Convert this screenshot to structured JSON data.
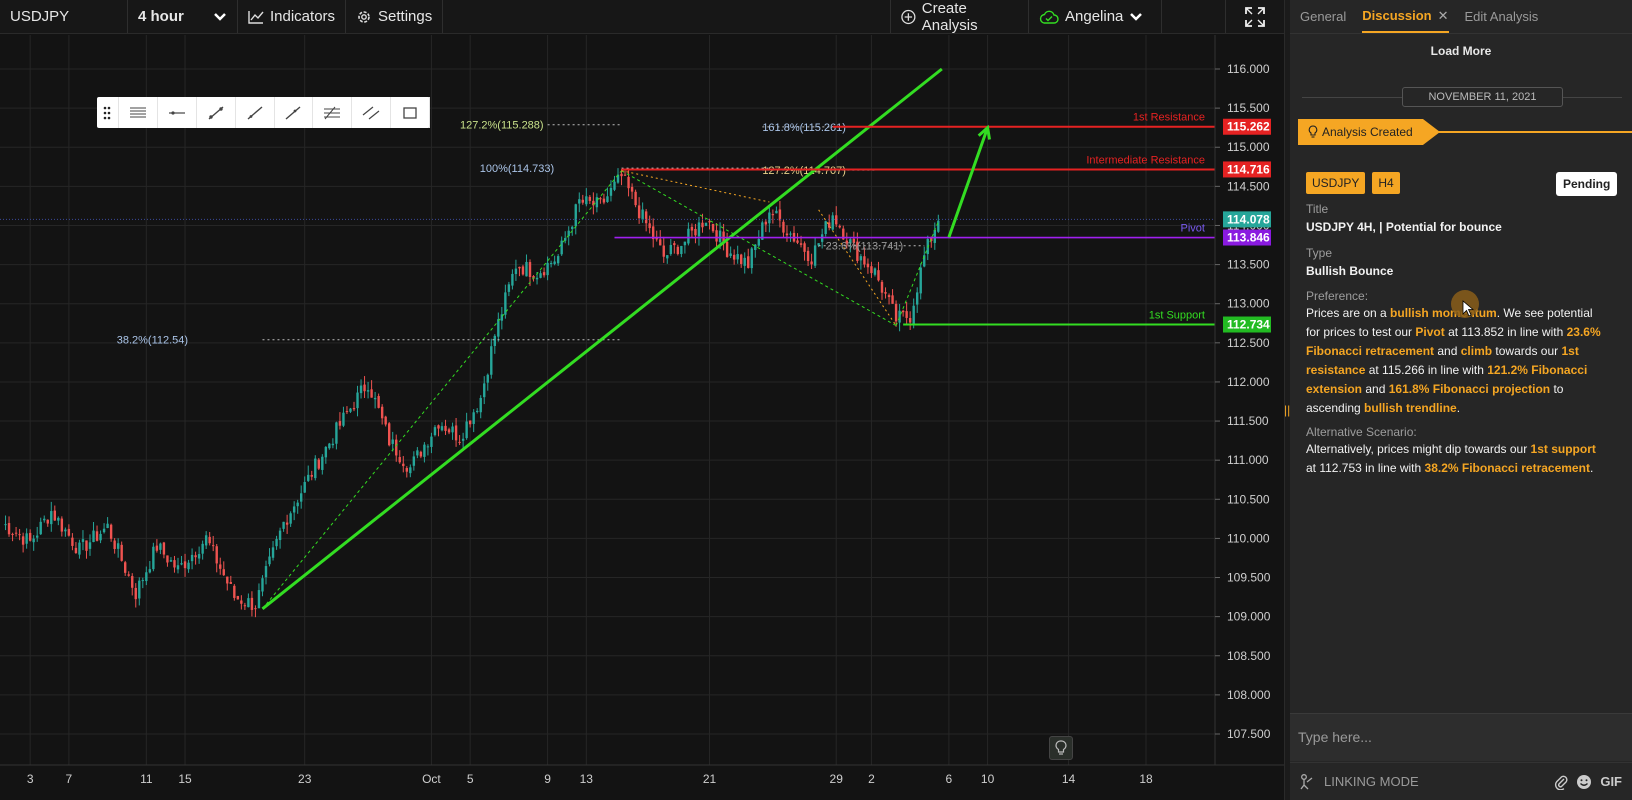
{
  "toolbar": {
    "symbol": "USDJPY",
    "timeframe": "4 hour",
    "indicators_label": "Indicators",
    "settings_label": "Settings",
    "create_analysis_label": "Create Analysis",
    "account_name": "Angelina"
  },
  "drawing_tools": [
    "grip-icon",
    "horizontal-lines-icon",
    "horizontal-ray-icon",
    "trend-line-icon",
    "line-icon",
    "ray-icon",
    "fib-retracement-icon",
    "parallel-channel-icon",
    "rectangle-icon"
  ],
  "colors": {
    "candle_up": "#26a69a",
    "candle_down": "#ef5350",
    "trendline": "#33dd22",
    "resistance": "#e52222",
    "pivot": "#a020f0",
    "support": "#33dd22",
    "accent": "#f5a623"
  },
  "chart_data": {
    "type": "candlestick",
    "symbol": "USDJPY",
    "timeframe": "H4",
    "ylim": [
      107.5,
      116.25
    ],
    "y_ticks": [
      "116.000",
      "115.500",
      "115.000",
      "114.500",
      "114.000",
      "113.500",
      "113.000",
      "112.500",
      "112.000",
      "111.500",
      "111.000",
      "110.500",
      "110.000",
      "109.500",
      "109.000",
      "108.500",
      "108.000",
      "107.500"
    ],
    "x_ticks": [
      "3",
      "7",
      "11",
      "15",
      "23",
      "Oct",
      "5",
      "9",
      "13",
      "21",
      "29",
      "2",
      "6",
      "10",
      "14",
      "18"
    ],
    "price_anchors": [
      {
        "bar": 0,
        "price": 110.2
      },
      {
        "bar": 8,
        "price": 109.95
      },
      {
        "bar": 14,
        "price": 110.35
      },
      {
        "bar": 22,
        "price": 109.85
      },
      {
        "bar": 30,
        "price": 110.15
      },
      {
        "bar": 38,
        "price": 109.3
      },
      {
        "bar": 44,
        "price": 109.9
      },
      {
        "bar": 50,
        "price": 109.6
      },
      {
        "bar": 58,
        "price": 110.0
      },
      {
        "bar": 66,
        "price": 109.25
      },
      {
        "bar": 72,
        "price": 109.15
      },
      {
        "bar": 80,
        "price": 110.2
      },
      {
        "bar": 90,
        "price": 111.0
      },
      {
        "bar": 98,
        "price": 111.6
      },
      {
        "bar": 104,
        "price": 112.0
      },
      {
        "bar": 110,
        "price": 111.25
      },
      {
        "bar": 116,
        "price": 110.9
      },
      {
        "bar": 124,
        "price": 111.5
      },
      {
        "bar": 130,
        "price": 111.3
      },
      {
        "bar": 136,
        "price": 111.8
      },
      {
        "bar": 140,
        "price": 112.6
      },
      {
        "bar": 146,
        "price": 113.5
      },
      {
        "bar": 152,
        "price": 113.4
      },
      {
        "bar": 158,
        "price": 113.6
      },
      {
        "bar": 164,
        "price": 114.3
      },
      {
        "bar": 170,
        "price": 114.25
      },
      {
        "bar": 176,
        "price": 114.62
      },
      {
        "bar": 182,
        "price": 114.1
      },
      {
        "bar": 188,
        "price": 113.6
      },
      {
        "bar": 194,
        "price": 113.8
      },
      {
        "bar": 200,
        "price": 114.1
      },
      {
        "bar": 206,
        "price": 113.7
      },
      {
        "bar": 212,
        "price": 113.5
      },
      {
        "bar": 218,
        "price": 114.2
      },
      {
        "bar": 224,
        "price": 113.9
      },
      {
        "bar": 230,
        "price": 113.6
      },
      {
        "bar": 236,
        "price": 114.15
      },
      {
        "bar": 242,
        "price": 113.7
      },
      {
        "bar": 248,
        "price": 113.4
      },
      {
        "bar": 254,
        "price": 112.8
      },
      {
        "bar": 258,
        "price": 112.85
      },
      {
        "bar": 262,
        "price": 113.6
      },
      {
        "bar": 266,
        "price": 114.1
      }
    ],
    "trendline": {
      "from": {
        "bar": 74,
        "price": 109.1
      },
      "to": {
        "bar": 267,
        "price": 116.0
      }
    },
    "levels": [
      {
        "name": "1st Resistance",
        "price": 115.262,
        "label": "115.262",
        "color": "#e52222",
        "start_bar": 236
      },
      {
        "name": "Intermediate Resistance",
        "price": 114.716,
        "label": "114.716",
        "color": "#e52222",
        "start_bar": 176
      },
      {
        "name": "Pivot",
        "price": 113.846,
        "label": "113.846",
        "color": "#a020f0",
        "start_bar": 174
      },
      {
        "name": "1st Support",
        "price": 112.734,
        "label": "112.734",
        "color": "#33dd22",
        "start_bar": 256
      }
    ],
    "current_price": {
      "price": 114.078,
      "label": "114.078"
    },
    "fib_labels": [
      {
        "text": "127.2%(115.288)",
        "price": 115.288,
        "bar": 155
      },
      {
        "text": "161.8%(115.261)",
        "price": 115.261,
        "bar": 216
      },
      {
        "text": "100%(114.733)",
        "price": 114.733,
        "bar": 158
      },
      {
        "text": "127.2%(114.707)",
        "price": 114.707,
        "bar": 216
      },
      {
        "text": "23.6%(113.741)",
        "price": 113.741,
        "bar": 234
      },
      {
        "text": "38.2%(112.54)",
        "price": 112.54,
        "bar": 54
      }
    ],
    "projection_arrow": {
      "from": {
        "bar": 269,
        "price": 113.85
      },
      "to": {
        "bar": 280,
        "price": 115.25
      }
    }
  },
  "panel": {
    "tabs": [
      {
        "label": "General",
        "active": false
      },
      {
        "label": "Discussion",
        "active": true
      },
      {
        "label": "Edit Analysis",
        "active": false
      }
    ],
    "load_more": "Load More",
    "date": "NOVEMBER 11, 2021",
    "created_label": "Analysis Created",
    "symbol_badge": "USDJPY",
    "timeframe_badge": "H4",
    "status": "Pending",
    "title_label": "Title",
    "title_value": "USDJPY 4H, | Potential for bounce",
    "type_label": "Type",
    "type_value": "Bullish Bounce",
    "preference_label": "Preference:",
    "preference": {
      "t1": "Prices are on a ",
      "h1": "bullish momentum",
      "t2": ". We see potential for prices to test our ",
      "h2": "Pivot",
      "t3": " at 113.852 in line with ",
      "h3": "23.6% Fibonacci retracement",
      "t4": " and ",
      "h4": "climb",
      "t5": " towards our ",
      "h5": "1st resistance",
      "t6": " at 115.266 in line with ",
      "h6": "121.2% Fibonacci extension",
      "t7": " and ",
      "h7": "161.8% Fibonacci projection",
      "t8": " to ascending ",
      "h8": "bullish trendline",
      "t9": "."
    },
    "alternative_label": "Alternative Scenario:",
    "alternative": {
      "t1": "Alternatively, prices might dip towards our ",
      "h1": "1st support",
      "t2": " at 112.753 in line with ",
      "h2": "38.2% Fibonacci retracement",
      "t3": "."
    },
    "input_placeholder": "Type here...",
    "linking_mode": "LINKING MODE",
    "gif_label": "GIF"
  }
}
